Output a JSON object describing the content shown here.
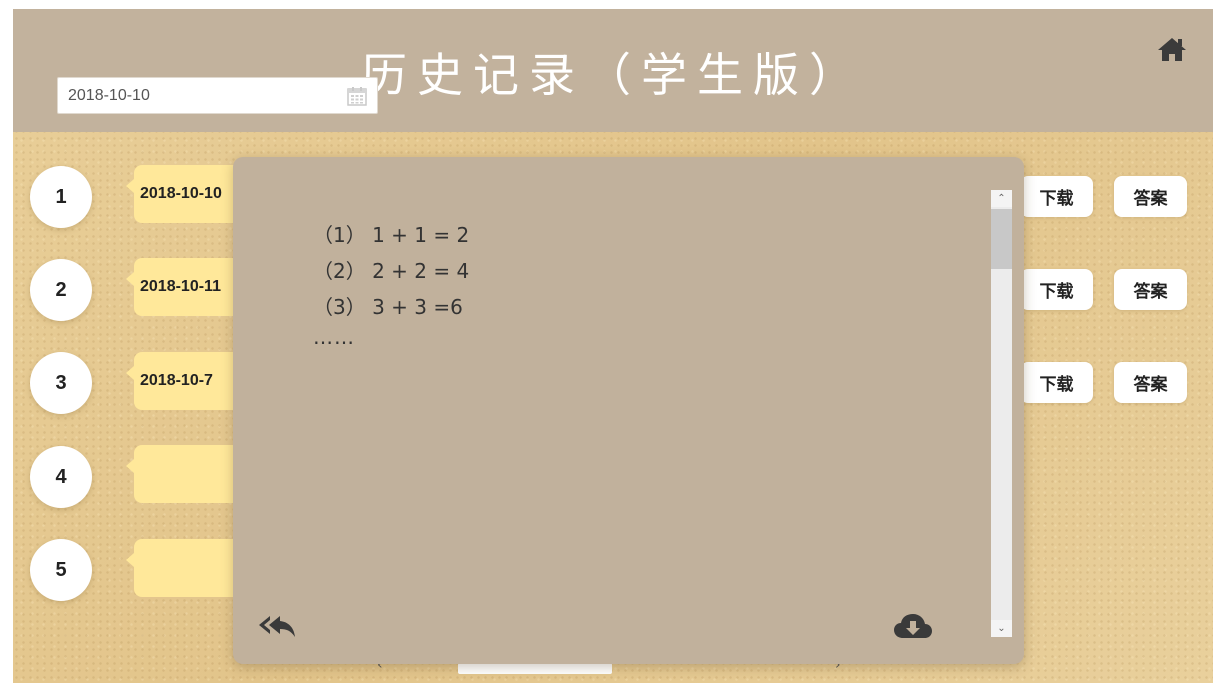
{
  "header": {
    "title": "历史记录（学生版）"
  },
  "date_picker": {
    "value": "2018-10-10"
  },
  "records": [
    {
      "number": "1",
      "date": "2018-10-10"
    },
    {
      "number": "2",
      "date": "2018-10-11"
    },
    {
      "number": "3",
      "date": "2018-10-7"
    },
    {
      "number": "4",
      "date": ""
    },
    {
      "number": "5",
      "date": ""
    }
  ],
  "actions": {
    "download_label": "下载",
    "answer_label": "答案"
  },
  "pager": {
    "prev": "‹",
    "next": "›"
  },
  "modal": {
    "questions": [
      "（1） 1 + 1 = 2",
      "（2） 2 + 2 = 4",
      "（3） 3 + 3 =6"
    ],
    "more": "……"
  },
  "icons": {
    "home": "home-icon",
    "calendar": "calendar-icon",
    "back": "reply-all-icon",
    "download": "cloud-download-icon"
  },
  "colors": {
    "header": "#c2b29d",
    "bubble": "#ffe89a",
    "background": "#e6cb93",
    "modal": "#c1b19c"
  }
}
